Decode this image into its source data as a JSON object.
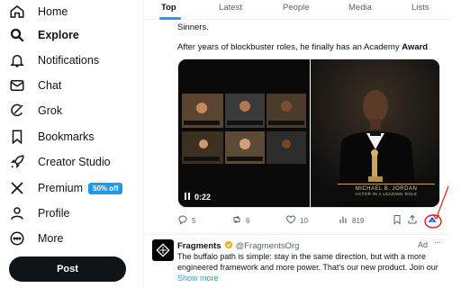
{
  "sidebar": {
    "items": [
      {
        "label": "Home",
        "icon": "home-icon"
      },
      {
        "label": "Explore",
        "icon": "search-icon"
      },
      {
        "label": "Notifications",
        "icon": "bell-icon"
      },
      {
        "label": "Chat",
        "icon": "mail-icon"
      },
      {
        "label": "Grok",
        "icon": "grok-icon"
      },
      {
        "label": "Bookmarks",
        "icon": "bookmark-icon"
      },
      {
        "label": "Creator Studio",
        "icon": "rocket-icon"
      },
      {
        "label": "Premium",
        "icon": "x-logo-icon",
        "badge": "50% off"
      },
      {
        "label": "Profile",
        "icon": "person-icon"
      },
      {
        "label": "More",
        "icon": "more-circle-icon"
      }
    ],
    "post_button": "Post"
  },
  "tabs": [
    "Top",
    "Latest",
    "People",
    "Media",
    "Lists"
  ],
  "tweet": {
    "text_line1": "Sinners.",
    "text_line2_prefix": "After years of blockbuster roles, he finally has an Academy ",
    "text_line2_bold": "Award",
    "video_time": "0:22",
    "caption_name": "MICHAEL B. JORDAN",
    "caption_sub": "ACTOR IN A LEADING ROLE",
    "replies": "5",
    "reposts": "6",
    "likes": "10",
    "views": "819"
  },
  "ad": {
    "name": "Fragments",
    "handle": "@FragmentsOrg",
    "label": "Ad",
    "more": "···",
    "line1": "The buffalo path is simple: stay in the same direction, but with a more",
    "line2": "engineered framework and more power. That's our new product.  Join our",
    "show_more": "Show more"
  },
  "colors": {
    "accent": "#1d9bf0",
    "text": "#0f1419",
    "muted": "#536471",
    "annotation": "#e0201b"
  }
}
